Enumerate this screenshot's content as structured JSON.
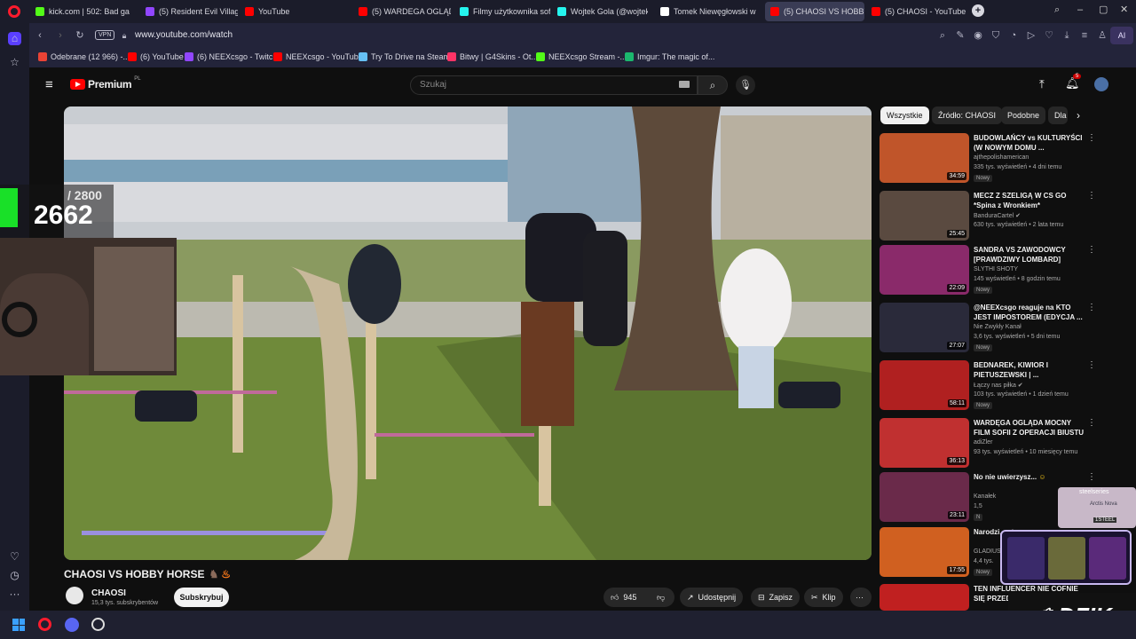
{
  "tabs": [
    {
      "label": "kick.com | 502: Bad gatew",
      "color": "#53fc18"
    },
    {
      "label": "(5) Resident Evil Village -",
      "color": "#9146ff"
    },
    {
      "label": "YouTube",
      "color": "#ff0000"
    },
    {
      "label": "(5) WARDEGA OGLĄDA L",
      "color": "#ff0000"
    },
    {
      "label": "Filmy użytkownika sofisiv",
      "color": "#ffffff"
    },
    {
      "label": "Wojtek Gola (@wojtekgo",
      "color": "#ffffff"
    },
    {
      "label": "Tomek Niewęgłowski w se",
      "color": "#ffffff"
    },
    {
      "label": "(5) CHAOSI VS HOBBY",
      "color": "#ff0000"
    },
    {
      "label": "(5) CHAOSI - YouTube",
      "color": "#ff0000"
    }
  ],
  "address": {
    "vpn": "VPN",
    "url": "www.youtube.com/watch",
    "ai": "AI"
  },
  "bookmarks": [
    {
      "label": "Odebrane (12 966) -...",
      "color": "#ea4335"
    },
    {
      "label": "(6) YouTube",
      "color": "#ff0000"
    },
    {
      "label": "(6) NEEXcsgo - Twitch",
      "color": "#9146ff"
    },
    {
      "label": "NEEXcsgo - YouTube",
      "color": "#ff0000"
    },
    {
      "label": "Try To Drive na Steam",
      "color": "#66c0f4"
    },
    {
      "label": "Bitwy | G4Skins - Ot...",
      "color": "#ff3366"
    },
    {
      "label": "NEEXcsgo Stream -...",
      "color": "#53fc18"
    },
    {
      "label": "Imgur: The magic of...",
      "color": "#1bb76e"
    }
  ],
  "yt": {
    "logo": "Premium",
    "region": "PL",
    "search_placeholder": "Szukaj",
    "notif_count": "5"
  },
  "video": {
    "title": "CHAOSI VS HOBBY HORSE",
    "channel": "CHAOSI",
    "subs": "15,3 tys. subskrybentów",
    "subscribe": "Subskrybuj",
    "likes": "945",
    "share": "Udostępnij",
    "save": "Zapisz",
    "clip": "Klip"
  },
  "overlay": {
    "counter_total": "/ 2800",
    "counter_value": "2662",
    "brand": "DZIK",
    "sponsor": "steelseries",
    "sponsor_product": "Arctis Nova",
    "sponsor_code": "1STEEL"
  },
  "chips": [
    "Wszystkie",
    "Źródło: CHAOSI",
    "Podobne",
    "Dla"
  ],
  "recs": [
    {
      "title": "BUDOWLAŃCY vs KULTURYŚCI (W NOWYM DOMU ...",
      "channel": "ajthepolishamerican",
      "meta": "335 tys. wyświetleń • 4 dni temu",
      "badge": "Nowy",
      "dur": "34:59",
      "bg": "#c0552a"
    },
    {
      "title": "MECZ Z SZELIGĄ W CS GO *Spina z Wronkiem*",
      "channel": "BanduraCartel",
      "meta": "630 tys. wyświetleń • 2 lata temu",
      "badge": "",
      "dur": "25:45",
      "bg": "#5a4a40"
    },
    {
      "title": "SANDRA VS ZAWODOWCY [PRAWDZIWY LOMBARD]",
      "channel": "SLYTHI SHOTY",
      "meta": "145 wyświetleń • 8 godzin temu",
      "badge": "Nowy",
      "dur": "22:09",
      "bg": "#8a2a6a"
    },
    {
      "title": "@NEEXcsgo reaguje na KTO JEST IMPOSTOREM (EDYCJA ...",
      "channel": "Nie Zwykły Kanał",
      "meta": "3,6 tys. wyświetleń • 5 dni temu",
      "badge": "Nowy",
      "dur": "27:07",
      "bg": "#2a2a3a"
    },
    {
      "title": "BEDNAREK, KIWIOR I PIETUSZEWSKI | ...",
      "channel": "Łączy nas piłka",
      "meta": "103 tys. wyświetleń • 1 dzień temu",
      "badge": "Nowy",
      "dur": "58:11",
      "bg": "#b02020"
    },
    {
      "title": "WARDĘGA OGLĄDA MOCNY FILM SOFII Z OPERACJI BIUSTU",
      "channel": "adiZler",
      "meta": "93 tys. wyświetleń • 10 miesięcy temu",
      "badge": "",
      "dur": "36:13",
      "bg": "#c03030"
    },
    {
      "title": "No nie uwierzysz...",
      "channel": "Kanałek",
      "meta": "1,5",
      "badge": "N",
      "dur": "23:11",
      "bg": "#6a2a4a"
    },
    {
      "title": "Narodzi... stream",
      "channel": "GLADIUS",
      "meta": "4,4 tys.",
      "badge": "Nowy",
      "dur": "17:55",
      "bg": "#d06020"
    },
    {
      "title": "TEN INFLUENCER NIE COFNIE SIĘ PRZED",
      "channel": "",
      "meta": "",
      "badge": "",
      "dur": "",
      "bg": "#c02020"
    }
  ]
}
